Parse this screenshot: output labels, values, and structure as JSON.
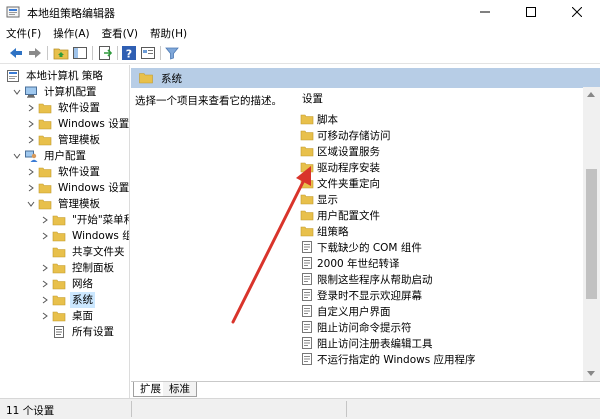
{
  "window": {
    "title": "本地组策略编辑器",
    "controls": [
      "minimize",
      "maximize",
      "close"
    ]
  },
  "menu": [
    "文件(F)",
    "操作(A)",
    "查看(V)",
    "帮助(H)"
  ],
  "toolbar": {
    "icons": [
      "back-icon",
      "forward-icon",
      "up-folder-icon",
      "show-hide-tree-icon",
      "export-list-icon",
      "help-icon",
      "properties-icon",
      "filter-icon"
    ]
  },
  "tree": {
    "items": [
      {
        "label": "本地计算机 策略",
        "icon": "computer-policy-icon"
      },
      {
        "label": "计算机配置",
        "icon": "computer-icon"
      },
      {
        "label": "软件设置",
        "icon": "folder-icon"
      },
      {
        "label": "Windows 设置",
        "icon": "folder-icon"
      },
      {
        "label": "管理模板",
        "icon": "folder-icon"
      },
      {
        "label": "用户配置",
        "icon": "user-icon"
      },
      {
        "label": "软件设置",
        "icon": "folder-icon"
      },
      {
        "label": "Windows 设置",
        "icon": "folder-icon"
      },
      {
        "label": "管理模板",
        "icon": "folder-icon"
      },
      {
        "label": "\"开始\"菜单和",
        "icon": "folder-icon"
      },
      {
        "label": "Windows 组",
        "icon": "folder-icon"
      },
      {
        "label": "共享文件夹",
        "icon": "folder-icon"
      },
      {
        "label": "控制面板",
        "icon": "folder-icon"
      },
      {
        "label": "网络",
        "icon": "folder-icon"
      },
      {
        "label": "系统",
        "icon": "folder-icon",
        "selected": true
      },
      {
        "label": "桌面",
        "icon": "folder-icon"
      },
      {
        "label": "所有设置",
        "icon": "all-settings-icon"
      }
    ]
  },
  "right": {
    "header": "系统",
    "description": "选择一个项目来查看它的描述。",
    "column_header": "设置",
    "folders": [
      "脚本",
      "可移动存储访问",
      "区域设置服务",
      "驱动程序安装",
      "文件夹重定向",
      "显示",
      "用户配置文件",
      "组策略"
    ],
    "settings": [
      "下载缺少的 COM 组件",
      "2000 年世纪转译",
      "限制这些程序从帮助启动",
      "登录时不显示欢迎屏幕",
      "自定义用户界面",
      "阻止访问命令提示符",
      "阻止访问注册表编辑工具",
      "不运行指定的 Windows 应用程序"
    ],
    "tabs": [
      "扩展",
      "标准"
    ]
  },
  "status": {
    "text": "11 个设置"
  },
  "colors": {
    "header_bar": "#b7cde6",
    "selected": "#cce8ff",
    "folder": "#e8c04b",
    "arrow": "#d9342b"
  }
}
